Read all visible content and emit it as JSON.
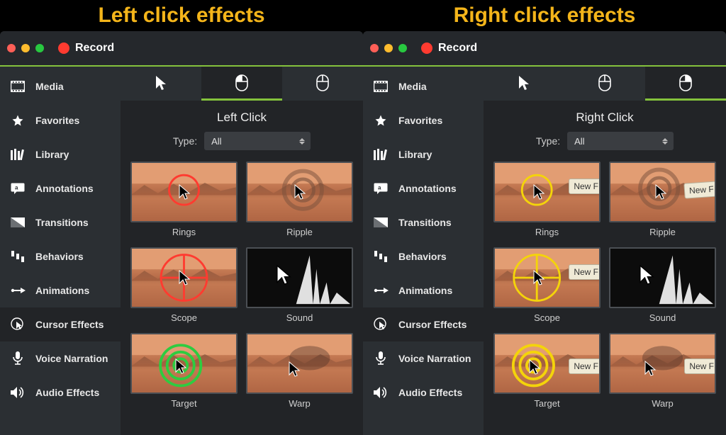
{
  "headlines": {
    "left": "Left click effects",
    "right": "Right click effects"
  },
  "record_label": "Record",
  "sidebar": {
    "items": [
      {
        "label": "Media"
      },
      {
        "label": "Favorites"
      },
      {
        "label": "Library"
      },
      {
        "label": "Annotations"
      },
      {
        "label": "Transitions"
      },
      {
        "label": "Behaviors"
      },
      {
        "label": "Animations"
      },
      {
        "label": "Cursor Effects"
      },
      {
        "label": "Voice Narration"
      },
      {
        "label": "Audio Effects"
      }
    ]
  },
  "type_label": "Type:",
  "type_value": "All",
  "panels": {
    "left": {
      "title": "Left Click",
      "effects": [
        {
          "label": "Rings"
        },
        {
          "label": "Ripple"
        },
        {
          "label": "Scope"
        },
        {
          "label": "Sound"
        },
        {
          "label": "Target"
        },
        {
          "label": "Warp"
        }
      ],
      "accent_color": "#ff3b30",
      "target_color": "#2ecc40"
    },
    "right": {
      "title": "Right Click",
      "effects": [
        {
          "label": "Rings"
        },
        {
          "label": "Ripple"
        },
        {
          "label": "Scope"
        },
        {
          "label": "Sound"
        },
        {
          "label": "Target"
        },
        {
          "label": "Warp"
        }
      ],
      "accent_color": "#f4d40a",
      "target_color": "#f4d40a",
      "file_tab_text": "New F"
    }
  }
}
